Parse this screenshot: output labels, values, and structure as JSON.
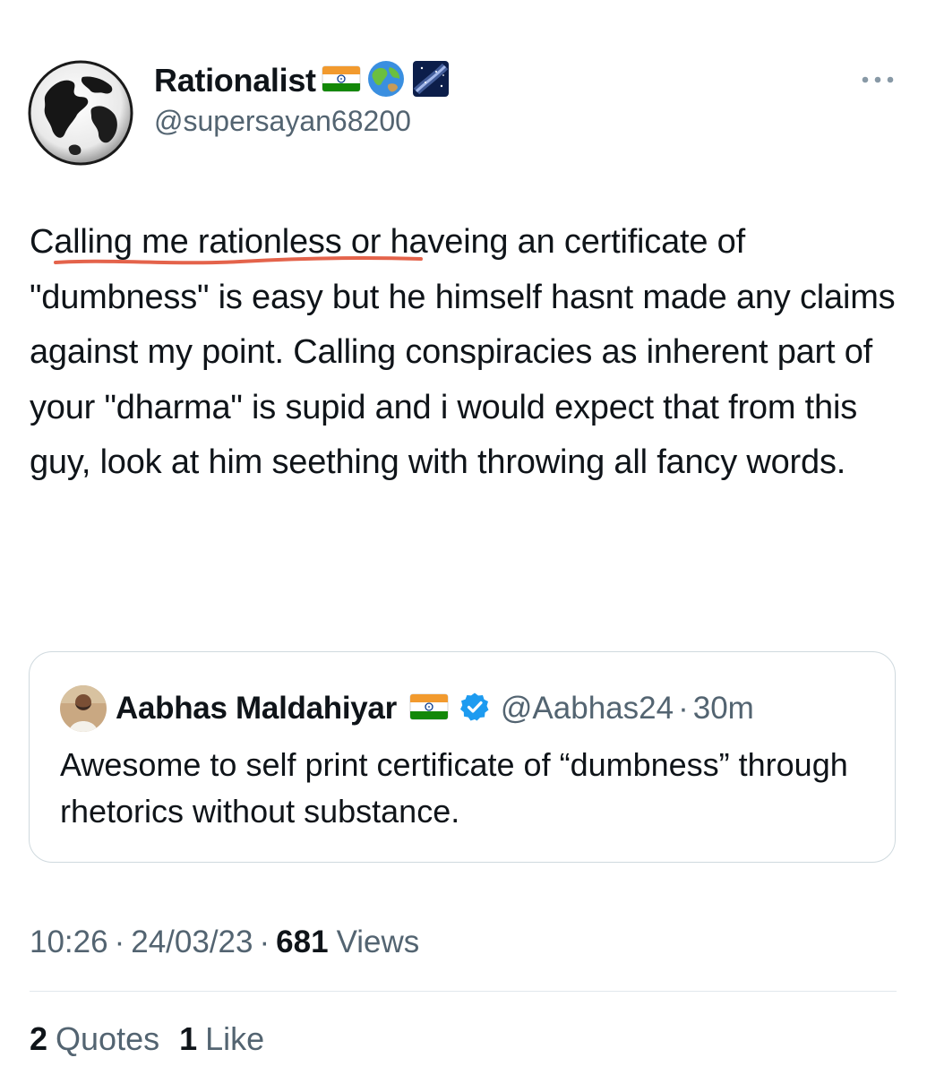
{
  "author": {
    "display_name": "Rationalist",
    "handle": "@supersayan68200",
    "icons": [
      "india-flag-icon",
      "globe-icon",
      "milky-way-icon"
    ]
  },
  "tweet": {
    "text": "Calling me rationless or haveing an certificate of \"dumbness\" is easy but he himself hasnt made any claims against my point. Calling conspiracies as inherent part of your \"dharma\" is supid and i would expect that from this guy, look at him seething with throwing all fancy words."
  },
  "quoted_tweet": {
    "display_name": "Aabhas Maldahiyar",
    "handle": "@Aabhas24",
    "separator": "·",
    "time": "30m",
    "text": "Awesome to self print certificate of “dumbness” through rhetorics without substance.",
    "icons": [
      "india-flag-icon",
      "verified-badge-icon"
    ]
  },
  "meta": {
    "time": "10:26",
    "separator": "·",
    "date": "24/03/23",
    "views_count": "681",
    "views_label": "Views"
  },
  "stats": {
    "quotes_count": "2",
    "quotes_label": "Quotes",
    "likes_count": "1",
    "likes_label": "Like"
  },
  "colors": {
    "text_primary": "#0f1419",
    "text_secondary": "#536471",
    "border": "#cfd9de",
    "verified_blue": "#1d9bf0",
    "underline_annotation": "#e4634b"
  }
}
